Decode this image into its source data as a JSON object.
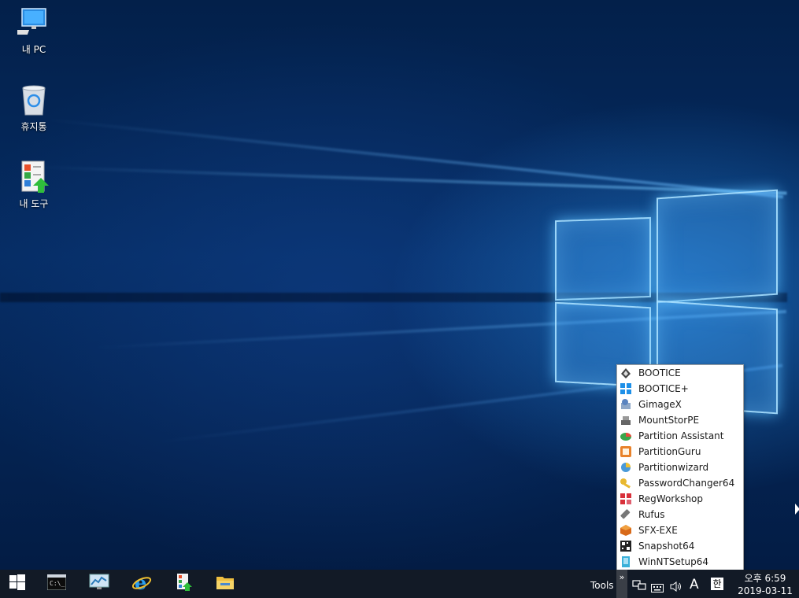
{
  "desktop": {
    "icons": [
      {
        "label": "내 PC",
        "icon": "pc-icon"
      },
      {
        "label": "휴지통",
        "icon": "recycle-bin-icon"
      },
      {
        "label": "내 도구",
        "icon": "tools-icon"
      }
    ]
  },
  "tools_menu": {
    "items": [
      {
        "label": "BOOTICE",
        "icon": "bootice-icon"
      },
      {
        "label": "BOOTICE+",
        "icon": "bootice-plus-icon"
      },
      {
        "label": "GimageX",
        "icon": "gimagex-icon"
      },
      {
        "label": "MountStorPE",
        "icon": "mountstorpe-icon"
      },
      {
        "label": "Partition Assistant",
        "icon": "partition-assistant-icon"
      },
      {
        "label": "PartitionGuru",
        "icon": "partitionguru-icon"
      },
      {
        "label": "Partitionwizard",
        "icon": "partitionwizard-icon"
      },
      {
        "label": "PasswordChanger64",
        "icon": "password-changer-icon"
      },
      {
        "label": "RegWorkshop",
        "icon": "regworkshop-icon"
      },
      {
        "label": "Rufus",
        "icon": "rufus-icon"
      },
      {
        "label": "SFX-EXE",
        "icon": "sfx-exe-icon"
      },
      {
        "label": "Snapshot64",
        "icon": "snapshot-icon"
      },
      {
        "label": "WinNTSetup64",
        "icon": "winntsetup-icon"
      }
    ]
  },
  "taskbar": {
    "pinned": [
      "start-icon",
      "command-prompt-icon",
      "system-monitor-icon",
      "internet-explorer-icon",
      "tools-icon",
      "file-explorer-icon"
    ],
    "toolbar_label": "Tools",
    "chevron": "»",
    "ime_letter": "A",
    "ime_korean": "한",
    "clock_time": "오후 6:59",
    "clock_date": "2019-03-11"
  }
}
